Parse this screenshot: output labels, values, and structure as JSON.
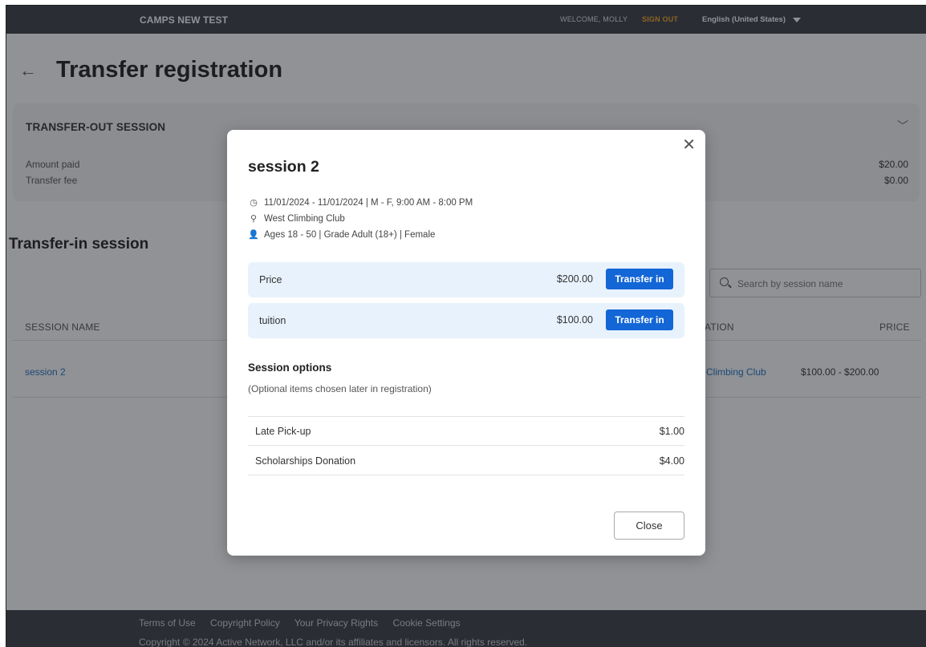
{
  "header": {
    "brand": "CAMPS NEW TEST",
    "welcome": "WELCOME, MOLLY",
    "sign_out": "SIGN OUT",
    "language": "English (United States)"
  },
  "page": {
    "title": "Transfer registration"
  },
  "transfer_out": {
    "title": "TRANSFER-OUT SESSION",
    "rows": [
      {
        "label": "Amount paid",
        "value": "$20.00"
      },
      {
        "label": "Transfer fee",
        "value": "$0.00"
      }
    ]
  },
  "transfer_in": {
    "title": "Transfer-in session",
    "search_placeholder": "Search by session name",
    "columns": {
      "session_name": "SESSION NAME",
      "location": "ATION",
      "price": "PRICE"
    },
    "rows": [
      {
        "session_name": "session 2",
        "location": "Climbing Club",
        "price": "$100.00 - $200.00"
      }
    ]
  },
  "footer": {
    "links": [
      "Terms of Use",
      "Copyright Policy",
      "Your Privacy Rights",
      "Cookie Settings"
    ],
    "copyright": "Copyright © 2024 Active Network, LLC and/or its affiliates and licensors. All rights reserved."
  },
  "modal": {
    "title": "session 2",
    "dates": "11/01/2024 - 11/01/2024 | M - F, 9:00 AM - 8:00 PM",
    "location": "West Climbing Club",
    "eligibility": "Ages 18 - 50 | Grade Adult (18+) | Female",
    "prices": [
      {
        "name": "Price",
        "amount": "$200.00",
        "button": "Transfer in"
      },
      {
        "name": "tuition",
        "amount": "$100.00",
        "button": "Transfer in"
      }
    ],
    "options_heading": "Session options",
    "options_sub": "(Optional items chosen later in registration)",
    "options": [
      {
        "name": "Late Pick-up",
        "price": "$1.00"
      },
      {
        "name": "Scholarships Donation",
        "price": "$4.00"
      }
    ],
    "close_label": "Close"
  },
  "colors": {
    "nav_bg": "#3a3f46",
    "sign_out": "#f5a623",
    "primary_button": "#1366d6",
    "link": "#1a73c9",
    "price_row_bg": "#e8f2fc"
  }
}
